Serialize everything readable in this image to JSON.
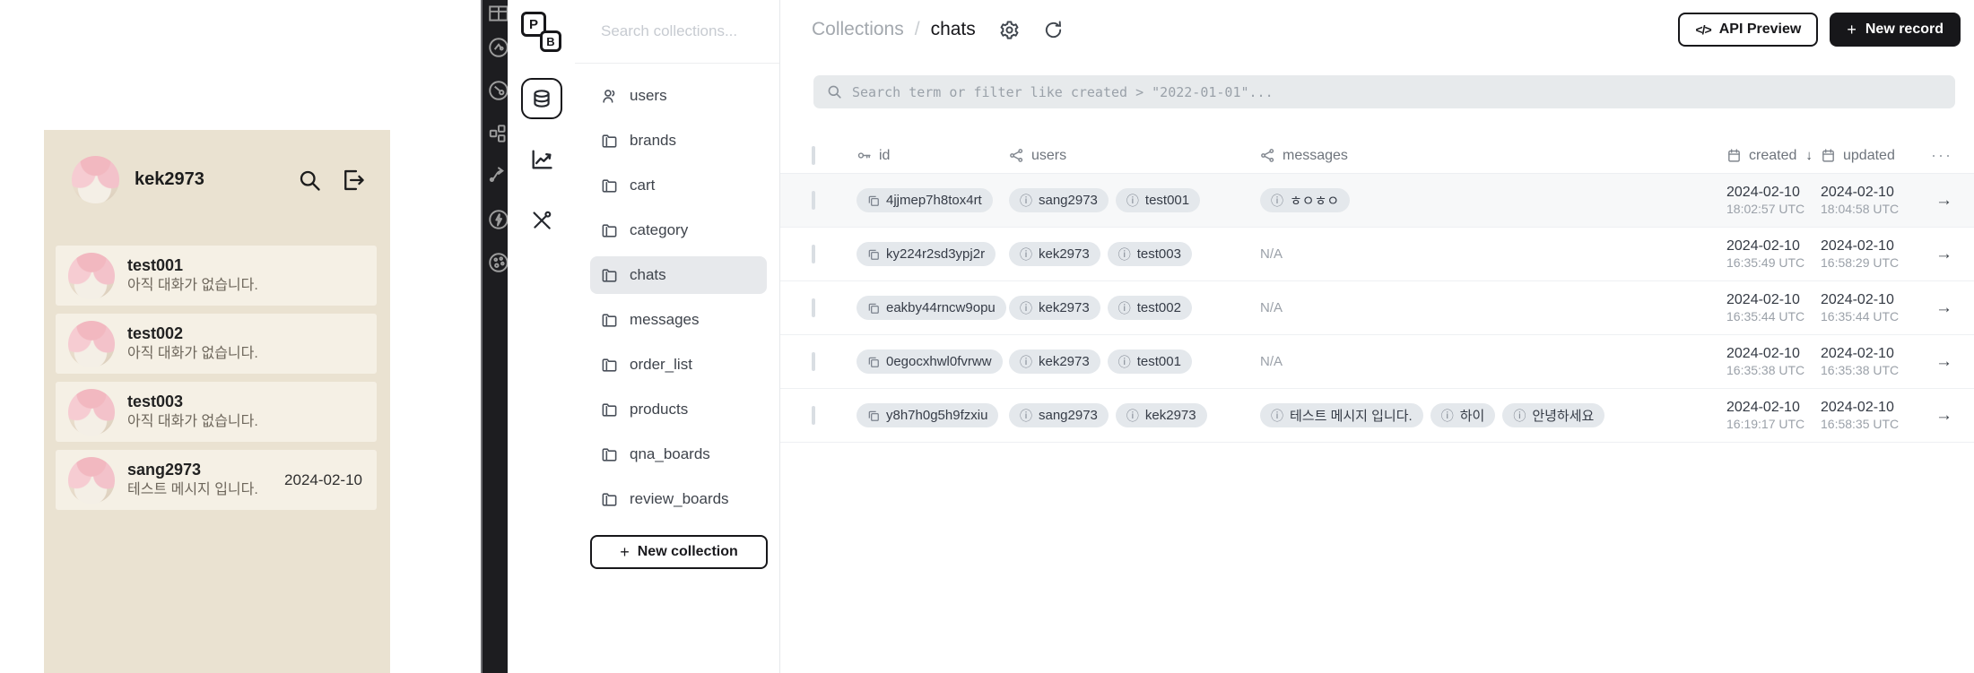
{
  "colors": {
    "chat_panel_bg": "#eae2d1",
    "chat_card_bg": "#f5f0e5",
    "dark_strip_bg": "#1d1d20",
    "accent_dark": "#17171a",
    "pill_bg": "#e4e8ec",
    "selected_collection_bg": "#e7e9ec",
    "filter_bar_bg": "#e7eaec"
  },
  "glyphs": {
    "info": "ⓘ",
    "arrow_right": "→",
    "sort_desc": "↓",
    "more": "···",
    "plus": "+",
    "code": "</>"
  },
  "chat_app": {
    "username": "kek2973",
    "chats": [
      {
        "name": "test001",
        "preview": "아직 대화가 없습니다.",
        "date": ""
      },
      {
        "name": "test002",
        "preview": "아직 대화가 없습니다.",
        "date": ""
      },
      {
        "name": "test003",
        "preview": "아직 대화가 없습니다.",
        "date": ""
      },
      {
        "name": "sang2973",
        "preview": "테스트 메시지 입니다.",
        "date": "2024-02-10"
      }
    ]
  },
  "pb": {
    "logo": {
      "p": "P",
      "b": "B"
    },
    "sidebar": {
      "search_placeholder": "Search collections...",
      "collections": [
        "users",
        "brands",
        "cart",
        "category",
        "chats",
        "messages",
        "order_list",
        "products",
        "qna_boards",
        "review_boards"
      ],
      "selected": "chats",
      "new_collection": "New collection"
    },
    "header": {
      "breadcrumb_root": "Collections",
      "breadcrumb_sep": "/",
      "breadcrumb_current": "chats",
      "api_preview": "API Preview",
      "new_record": "New record"
    },
    "filter": {
      "placeholder": "Search term or filter like created > \"2022-01-01\"..."
    },
    "table": {
      "headers": {
        "id": "id",
        "users": "users",
        "messages": "messages",
        "created": "created",
        "updated": "updated"
      },
      "na": "N/A",
      "rows": [
        {
          "id": "4jjmep7h8tox4rt",
          "users": [
            "sang2973",
            "test001"
          ],
          "messages": [
            "ㅎㅇㅎㅇ"
          ],
          "created_date": "2024-02-10",
          "created_time": "18:02:57 UTC",
          "updated_date": "2024-02-10",
          "updated_time": "18:04:58 UTC"
        },
        {
          "id": "ky224r2sd3ypj2r",
          "users": [
            "kek2973",
            "test003"
          ],
          "messages": [],
          "created_date": "2024-02-10",
          "created_time": "16:35:49 UTC",
          "updated_date": "2024-02-10",
          "updated_time": "16:58:29 UTC"
        },
        {
          "id": "eakby44rncw9opu",
          "users": [
            "kek2973",
            "test002"
          ],
          "messages": [],
          "created_date": "2024-02-10",
          "created_time": "16:35:44 UTC",
          "updated_date": "2024-02-10",
          "updated_time": "16:35:44 UTC"
        },
        {
          "id": "0egocxhwl0fvrww",
          "users": [
            "kek2973",
            "test001"
          ],
          "messages": [],
          "created_date": "2024-02-10",
          "created_time": "16:35:38 UTC",
          "updated_date": "2024-02-10",
          "updated_time": "16:35:38 UTC"
        },
        {
          "id": "y8h7h0g5h9fzxiu",
          "users": [
            "sang2973",
            "kek2973"
          ],
          "messages": [
            "테스트 메시지 입니다.",
            "하이",
            "안녕하세요"
          ],
          "created_date": "2024-02-10",
          "created_time": "16:19:17 UTC",
          "updated_date": "2024-02-10",
          "updated_time": "16:58:35 UTC"
        }
      ]
    }
  }
}
